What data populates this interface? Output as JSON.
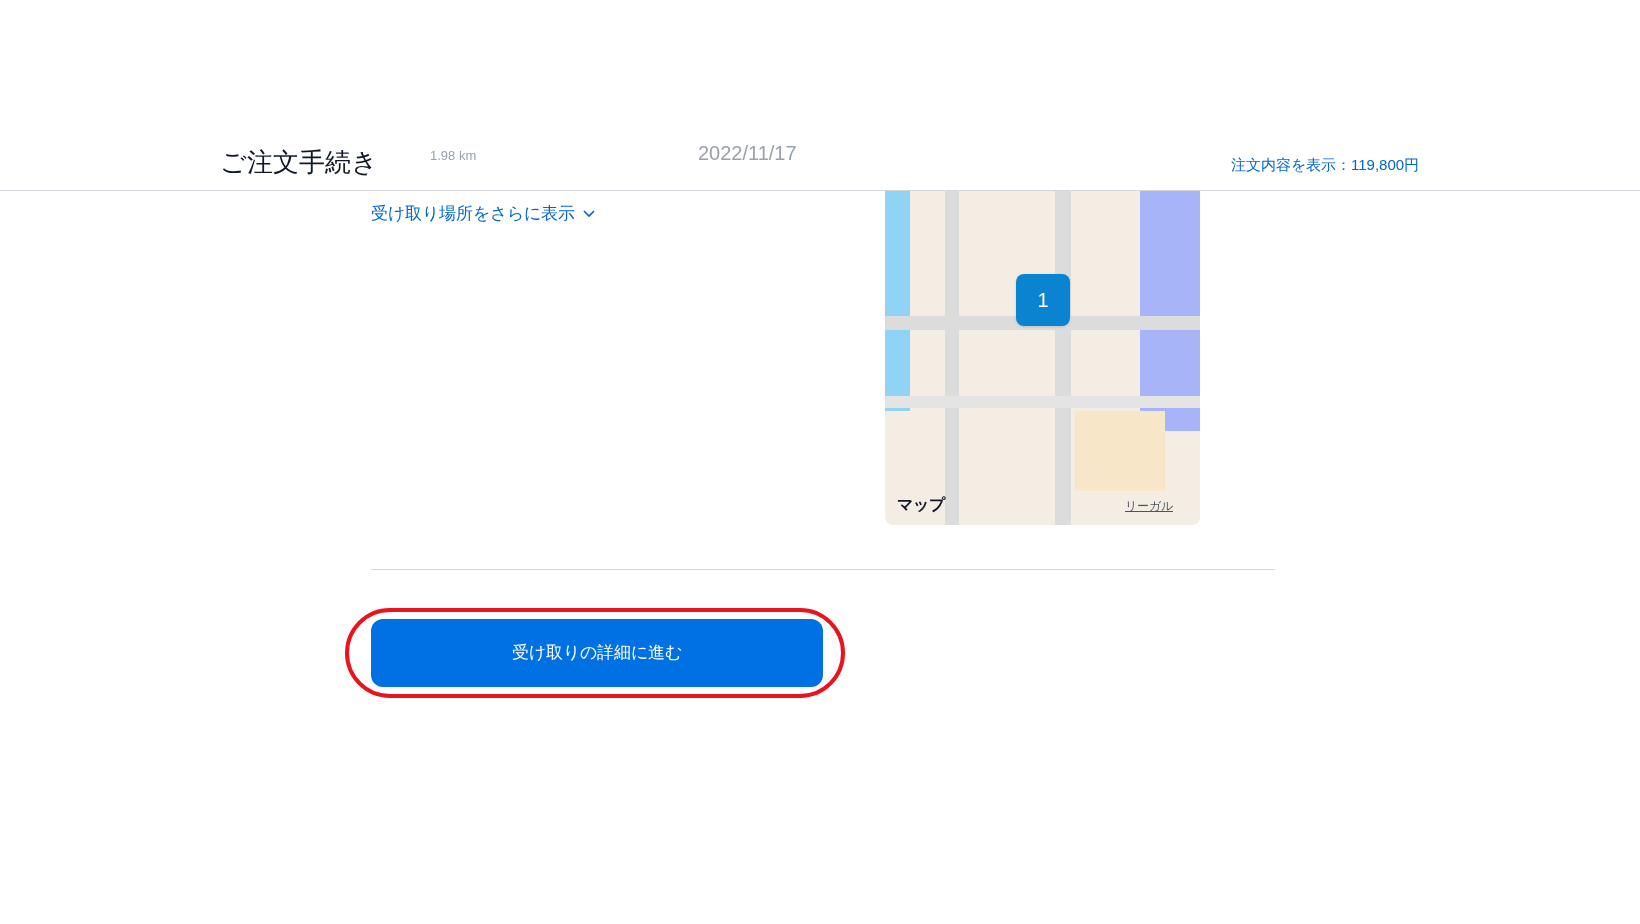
{
  "header": {
    "title": "ご注文手続き",
    "summary_link": "注文内容を表示：119,800円",
    "underlying_texts": [
      "1.98 km",
      "2022/11/17"
    ]
  },
  "pickup": {
    "more_link": "受け取り場所をさらに表示",
    "map": {
      "pin_label": "1",
      "attribution": "マップ",
      "legal_link": "リーガル"
    }
  },
  "continue_button": {
    "label": "受け取りの詳細に進む",
    "highlighted": true
  }
}
